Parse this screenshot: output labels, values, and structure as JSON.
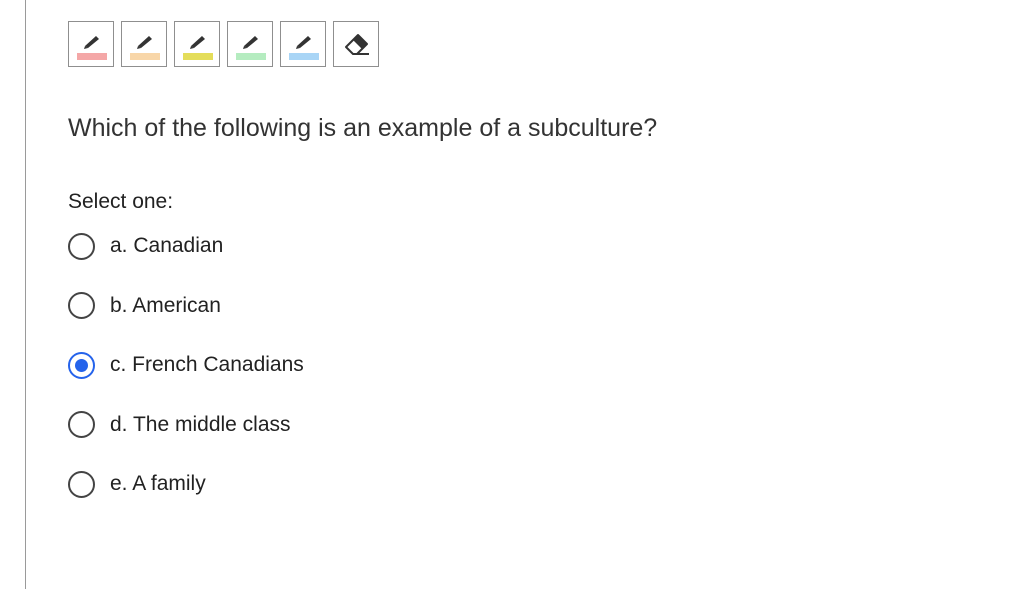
{
  "toolbar": {
    "tools": [
      {
        "name": "highlighter-pink",
        "color": "#f4a7a7"
      },
      {
        "name": "highlighter-peach",
        "color": "#f8d6a8"
      },
      {
        "name": "highlighter-yellow",
        "color": "#e4dd5a"
      },
      {
        "name": "highlighter-green",
        "color": "#b5ecc0"
      },
      {
        "name": "highlighter-blue",
        "color": "#a9d5f6"
      }
    ],
    "eraser": "eraser-icon"
  },
  "question": {
    "text": "Which of the following is an example of a subculture?",
    "prompt": "Select one:",
    "options": [
      {
        "label": "a. Canadian",
        "selected": false
      },
      {
        "label": "b. American",
        "selected": false
      },
      {
        "label": "c. French Canadians",
        "selected": true
      },
      {
        "label": "d. The middle class",
        "selected": false
      },
      {
        "label": "e. A family",
        "selected": false
      }
    ]
  },
  "colors": {
    "accent": "#2563eb"
  }
}
